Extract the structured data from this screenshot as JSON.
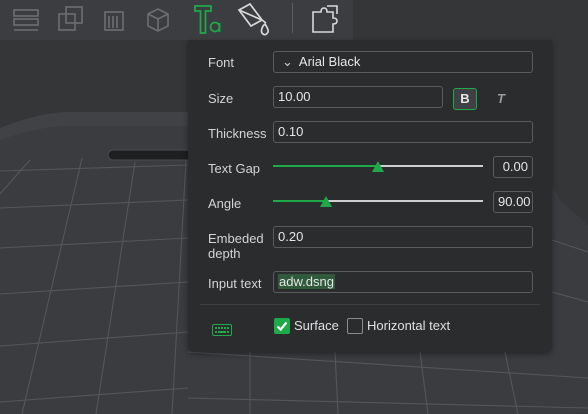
{
  "toolbar": {
    "tools": [
      {
        "icon": "layers-icon"
      },
      {
        "icon": "boolean-icon"
      },
      {
        "icon": "slice-icon"
      },
      {
        "icon": "cube-icon"
      },
      {
        "icon": "text-tool-icon",
        "active": true
      },
      {
        "icon": "paint-bucket-icon"
      },
      {
        "icon": "assembly-icon"
      }
    ]
  },
  "text_panel": {
    "font": {
      "label": "Font",
      "value": "Arial Black"
    },
    "size": {
      "label": "Size",
      "value": "10.00",
      "bold_label": "B",
      "italic_label": "T",
      "bold_active": true
    },
    "thickness": {
      "label": "Thickness",
      "value": "0.10"
    },
    "text_gap": {
      "label": "Text Gap",
      "value": "0.00",
      "slider_fraction": 0.5
    },
    "angle": {
      "label": "Angle",
      "value": "90.00",
      "slider_fraction": 0.25
    },
    "embeded_depth": {
      "label_line1": "Embeded",
      "label_line2": "depth",
      "value": "0.20"
    },
    "input_text": {
      "label": "Input text",
      "value": "adw.dsng"
    },
    "options": {
      "keyboard_icon": "keyboard-icon",
      "surface": {
        "label": "Surface",
        "checked": true
      },
      "horizontal_text": {
        "label": "Horizontal text",
        "checked": false
      }
    }
  },
  "colors": {
    "accent": "#1faa4a",
    "panel": "#2b2c2e",
    "viewport": "#343638"
  }
}
